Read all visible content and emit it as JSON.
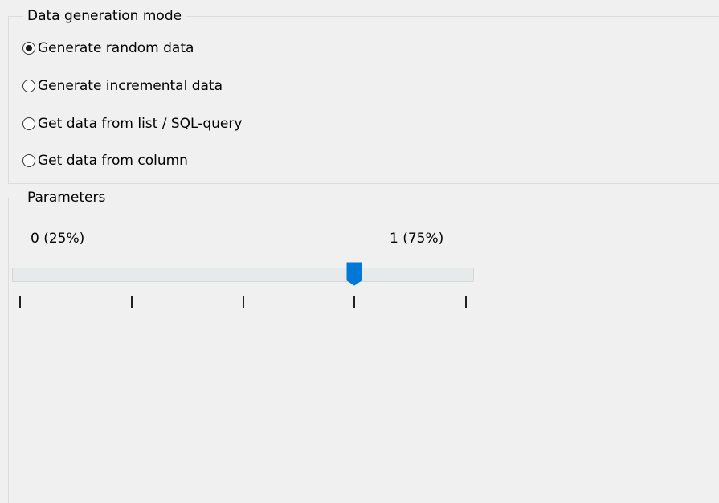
{
  "mode_group": {
    "legend": "Data generation mode",
    "options": [
      {
        "label": "Generate random data",
        "checked": true
      },
      {
        "label": "Generate incremental data",
        "checked": false
      },
      {
        "label": "Get data from list / SQL-query",
        "checked": false
      },
      {
        "label": "Get data from column",
        "checked": false
      }
    ]
  },
  "params_group": {
    "legend": "Parameters",
    "slider": {
      "low_label": "0 (25%)",
      "high_label": "1 (75%)",
      "value_fraction": 0.75,
      "tick_count": 5,
      "thumb_color": "#0078d7"
    }
  }
}
